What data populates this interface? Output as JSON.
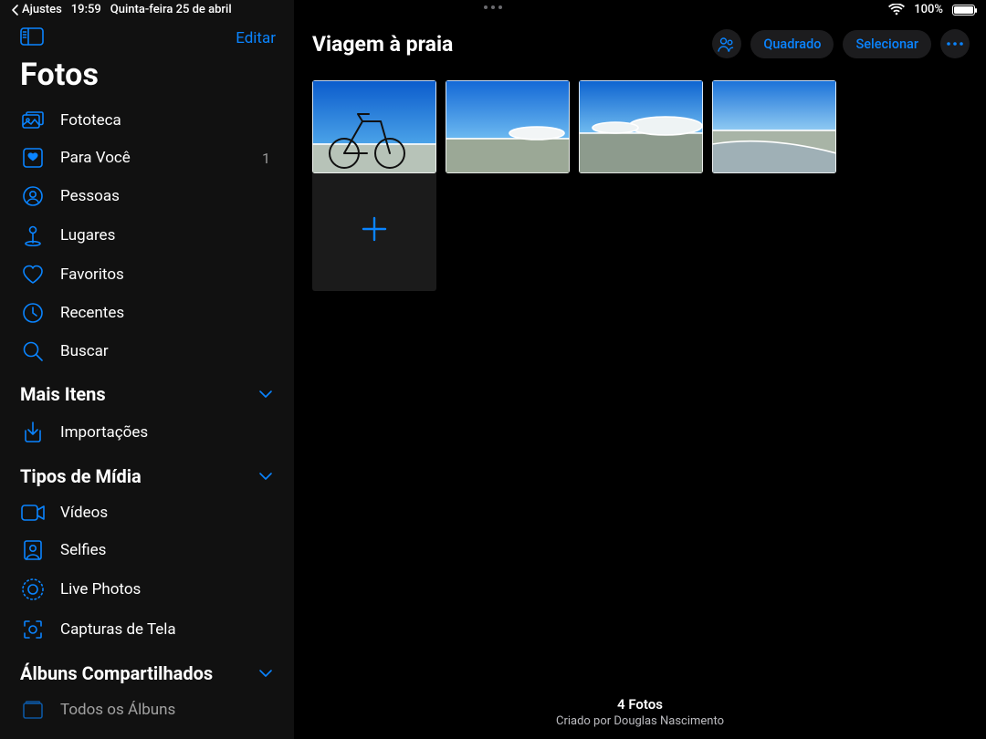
{
  "status": {
    "back_app": "Ajustes",
    "time": "19:59",
    "date": "Quinta-feira 25 de abril",
    "battery_pct": "100%"
  },
  "sidebar": {
    "edit": "Editar",
    "title": "Fotos",
    "items": [
      {
        "icon": "library",
        "label": "Fototeca",
        "badge": ""
      },
      {
        "icon": "foryou",
        "label": "Para Você",
        "badge": "1"
      },
      {
        "icon": "people",
        "label": "Pessoas",
        "badge": ""
      },
      {
        "icon": "places",
        "label": "Lugares",
        "badge": ""
      },
      {
        "icon": "heart",
        "label": "Favoritos",
        "badge": ""
      },
      {
        "icon": "clock",
        "label": "Recentes",
        "badge": ""
      },
      {
        "icon": "search",
        "label": "Buscar",
        "badge": ""
      }
    ],
    "section_more": "Mais Itens",
    "more_items": [
      {
        "icon": "import",
        "label": "Importações"
      }
    ],
    "section_media": "Tipos de Mídia",
    "media_items": [
      {
        "icon": "video",
        "label": "Vídeos"
      },
      {
        "icon": "selfie",
        "label": "Selfies"
      },
      {
        "icon": "livephoto",
        "label": "Live Photos"
      },
      {
        "icon": "screenshot",
        "label": "Capturas de Tela"
      }
    ],
    "section_shared": "Álbuns Compartilhados",
    "shared_items": [
      {
        "icon": "album",
        "label": "Todos os Álbuns"
      }
    ]
  },
  "main": {
    "album_title": "Viagem à praia",
    "button_aspect": "Quadrado",
    "button_select": "Selecionar",
    "photo_count": 4,
    "footer_count": "4 Fotos",
    "footer_sub": "Criado por Douglas Nascimento"
  }
}
